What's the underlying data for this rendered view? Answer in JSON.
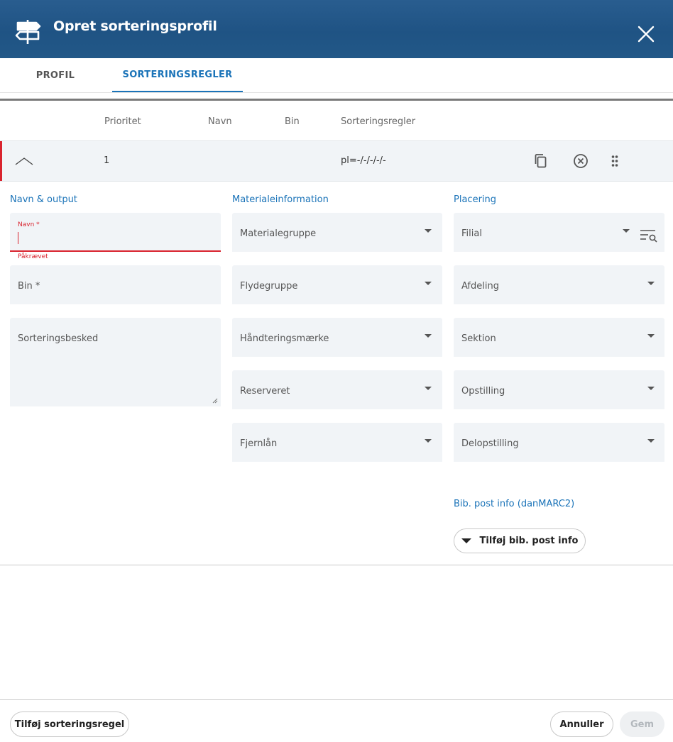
{
  "header": {
    "title": "Opret sorteringsprofil"
  },
  "tabs": [
    {
      "label": "PROFIL"
    },
    {
      "label": "SORTERINGSREGLER"
    }
  ],
  "columns": {
    "priority": "Prioritet",
    "name": "Navn",
    "bin": "Bin",
    "rules": "Sorteringsregler"
  },
  "rule_row": {
    "priority": "1",
    "rules": "pl=-/-/-/-/-"
  },
  "sections": {
    "name_output": "Navn & output",
    "material": "Materialeinformation",
    "placement": "Placering",
    "bib": "Bib. post info (danMARC2)"
  },
  "form": {
    "name_label": "Navn *",
    "name_error": "Påkrævet",
    "bin_label": "Bin *",
    "message_label": "Sorteringsbesked",
    "material_fields": [
      "Materialegruppe",
      "Flydegruppe",
      "Håndteringsmærke",
      "Reserveret",
      "Fjernlån"
    ],
    "placement_fields": [
      "Filial",
      "Afdeling",
      "Sektion",
      "Opstilling",
      "Delopstilling"
    ]
  },
  "buttons": {
    "add_bib": "Tilføj bib. post info",
    "add_rule": "Tilføj sorteringsregel",
    "cancel": "Annuller",
    "save": "Gem"
  },
  "colors": {
    "header": "#225887",
    "accent": "#1a73b8",
    "error": "#d9232e",
    "field_bg": "#f1f4f7"
  }
}
